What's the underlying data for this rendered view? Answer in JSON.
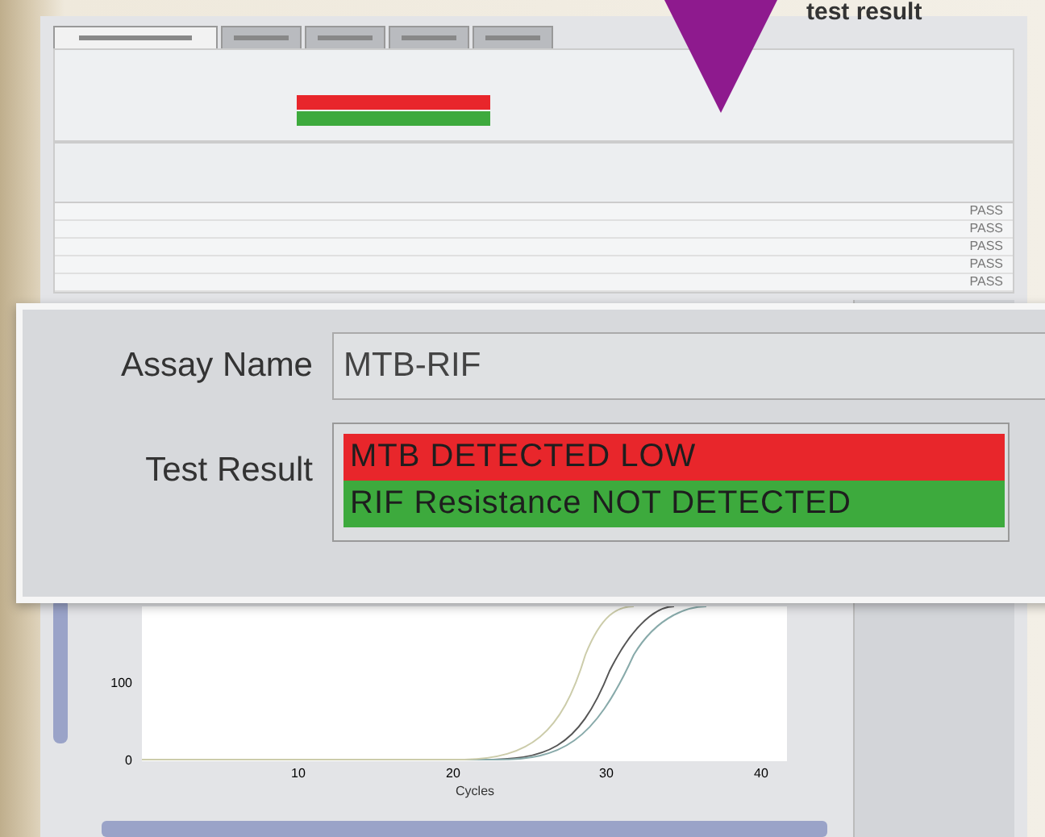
{
  "callout_caption": "test result",
  "tabs": [
    {
      "selected": true
    },
    {
      "selected": false
    },
    {
      "selected": false
    },
    {
      "selected": false
    },
    {
      "selected": false
    }
  ],
  "result_panel": {
    "assay_label": "Assay Name",
    "assay_value": "MTB-RIF",
    "result_label": "Test Result",
    "results": [
      {
        "text": "MTB DETECTED LOW",
        "color": "#e8262b"
      },
      {
        "text": "RIF Resistance NOT DETECTED",
        "color": "#3daa3d"
      }
    ]
  },
  "table": {
    "rows": [
      {
        "column_5": "PASS"
      },
      {
        "column_5": "PASS"
      },
      {
        "column_5": "PASS"
      },
      {
        "column_5": "PASS"
      },
      {
        "column_5": "PASS"
      }
    ]
  },
  "plot": {
    "y_ticks": [
      "100",
      "0"
    ],
    "x_ticks": [
      "10",
      "20",
      "30",
      "40"
    ],
    "x_label": "Cycles"
  }
}
